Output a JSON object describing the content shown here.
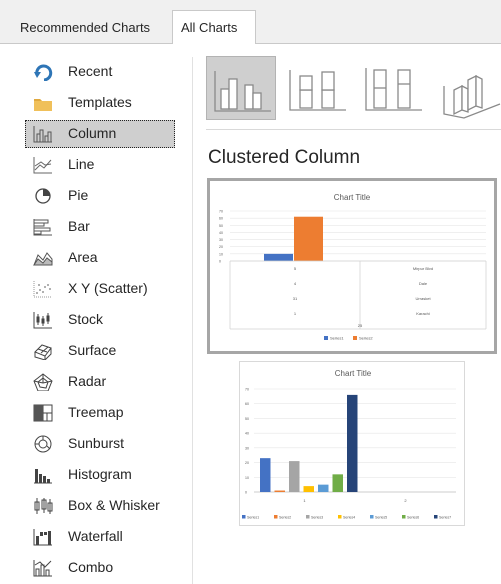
{
  "tabs": {
    "recommended": "Recommended Charts",
    "all": "All Charts"
  },
  "sidebar": {
    "items": [
      {
        "label": "Recent",
        "icon": "recent-icon"
      },
      {
        "label": "Templates",
        "icon": "folder-icon"
      },
      {
        "label": "Column",
        "icon": "column-chart-icon",
        "selected": true
      },
      {
        "label": "Line",
        "icon": "line-chart-icon"
      },
      {
        "label": "Pie",
        "icon": "pie-chart-icon"
      },
      {
        "label": "Bar",
        "icon": "bar-chart-icon"
      },
      {
        "label": "Area",
        "icon": "area-chart-icon"
      },
      {
        "label": "X Y (Scatter)",
        "icon": "scatter-chart-icon"
      },
      {
        "label": "Stock",
        "icon": "stock-chart-icon"
      },
      {
        "label": "Surface",
        "icon": "surface-chart-icon"
      },
      {
        "label": "Radar",
        "icon": "radar-chart-icon"
      },
      {
        "label": "Treemap",
        "icon": "treemap-chart-icon"
      },
      {
        "label": "Sunburst",
        "icon": "sunburst-chart-icon"
      },
      {
        "label": "Histogram",
        "icon": "histogram-chart-icon"
      },
      {
        "label": "Box & Whisker",
        "icon": "box-whisker-chart-icon"
      },
      {
        "label": "Waterfall",
        "icon": "waterfall-chart-icon"
      },
      {
        "label": "Combo",
        "icon": "combo-chart-icon"
      }
    ]
  },
  "subtypes": [
    "clustered-column",
    "stacked-column",
    "100-stacked-column",
    "3d-clustered-column"
  ],
  "chart_type_title": "Clustered Column",
  "colors": {
    "accent_blue": "#2e75b6",
    "icon_blue": "#2e75b6",
    "folder": "#f0c05a",
    "selection": "#cfcfcf"
  },
  "chart_data": [
    {
      "type": "bar",
      "title": "Chart Title",
      "y_ticks": [
        "70",
        "60",
        "50",
        "40",
        "30",
        "20",
        "10",
        "0"
      ],
      "categories": [
        "5",
        "4",
        "31",
        "1"
      ],
      "categories_right": [
        "Mirpur Blvd",
        "Dale",
        "Urrasket",
        "Karachi"
      ],
      "category_bottom": "25",
      "series": [
        {
          "name": "Series1",
          "color": "#4472c4",
          "values": [
            10
          ]
        },
        {
          "name": "Series2",
          "color": "#ed7d31",
          "values": [
            62
          ]
        }
      ],
      "legend": "bottom",
      "ylim": [
        0,
        70
      ]
    },
    {
      "type": "bar",
      "title": "Chart Title",
      "y_ticks": [
        "70",
        "60",
        "50",
        "40",
        "30",
        "20",
        "10",
        "0"
      ],
      "categories": [
        "1",
        "2"
      ],
      "series": [
        {
          "name": "Series1",
          "color": "#4472c4",
          "values": [
            23,
            0
          ]
        },
        {
          "name": "Series2",
          "color": "#ed7d31",
          "values": [
            1,
            0
          ]
        },
        {
          "name": "Series3",
          "color": "#a5a5a5",
          "values": [
            21,
            0
          ]
        },
        {
          "name": "Series4",
          "color": "#ffc000",
          "values": [
            4,
            0
          ]
        },
        {
          "name": "Series5",
          "color": "#5b9bd5",
          "values": [
            5,
            0
          ]
        },
        {
          "name": "Series6",
          "color": "#70ad47",
          "values": [
            12,
            0
          ]
        },
        {
          "name": "Series7",
          "color": "#264478",
          "values": [
            66,
            0
          ]
        }
      ],
      "legend": "bottom",
      "ylim": [
        0,
        70
      ]
    }
  ]
}
